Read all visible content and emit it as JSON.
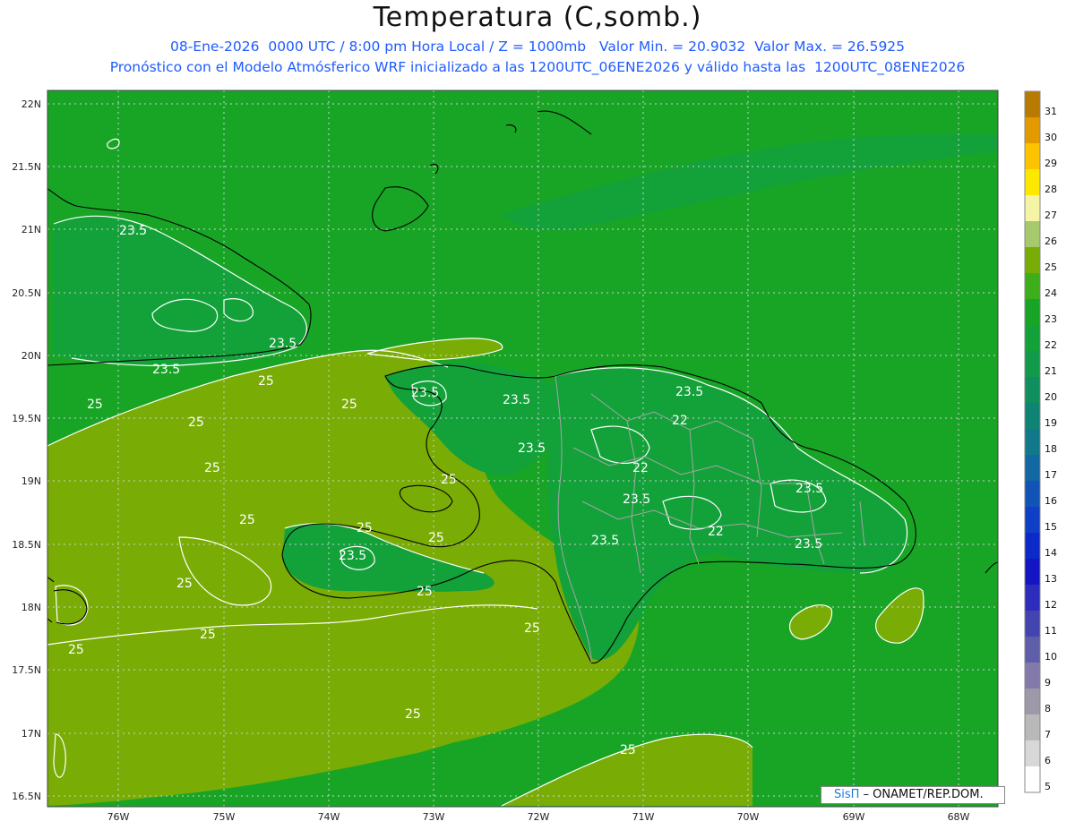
{
  "header": {
    "title": "Temperatura (C,somb.)",
    "line1": "08-Ene-2026  0000 UTC / 8:00 pm Hora Local / Z = 1000mb   Valor Min. = 20.9032  Valor Max. = 26.5925",
    "line2": "Pronóstico con el Modelo Atmósferico WRF inicializado a las 1200UTC_06ENE2026 y válido hasta las  1200UTC_08ENE2026"
  },
  "axes": {
    "lat_labels": [
      "22N",
      "21.5N",
      "21N",
      "20.5N",
      "20N",
      "19.5N",
      "19N",
      "18.5N",
      "18N",
      "17.5N",
      "17N",
      "16.5N"
    ],
    "lon_labels": [
      "76W",
      "75W",
      "74W",
      "73W",
      "72W",
      "71W",
      "70W",
      "69W",
      "68W"
    ]
  },
  "contour_labels": [
    "23.5",
    "23.5",
    "23.5",
    "23.5",
    "23.5",
    "23.5",
    "23.5",
    "23.5",
    "23.5",
    "23.5",
    "23.5",
    "23.5",
    "22",
    "22",
    "22",
    "25",
    "25",
    "25",
    "25",
    "25",
    "25",
    "25",
    "25",
    "25",
    "25",
    "25",
    "25",
    "25",
    "25",
    "25",
    "25"
  ],
  "colorbar": {
    "labels": [
      "31",
      "30",
      "29",
      "28",
      "27",
      "26",
      "25",
      "24",
      "23",
      "22",
      "21",
      "20",
      "19",
      "18",
      "17",
      "16",
      "15",
      "14",
      "13",
      "12",
      "11",
      "10",
      "9",
      "8",
      "7",
      "6",
      "5"
    ],
    "colors": [
      "#b87a00",
      "#e39a00",
      "#fdc200",
      "#fde800",
      "#f4f4a4",
      "#a6c96b",
      "#7aac06",
      "#3cae1a",
      "#18a526",
      "#13a13a",
      "#119a4a",
      "#0f8f5e",
      "#0f8474",
      "#11798a",
      "#1268a2",
      "#1153b6",
      "#0f3fc6",
      "#0b2ac8",
      "#1416c4",
      "#2d2cbc",
      "#4444b0",
      "#5f5ea8",
      "#8379ab",
      "#9e99a8",
      "#b9b9b9",
      "#d8d8d8",
      "#ffffff"
    ]
  },
  "credit": {
    "brand": "SisΠ",
    "text": " – ONAMET/REP.DOM."
  }
}
